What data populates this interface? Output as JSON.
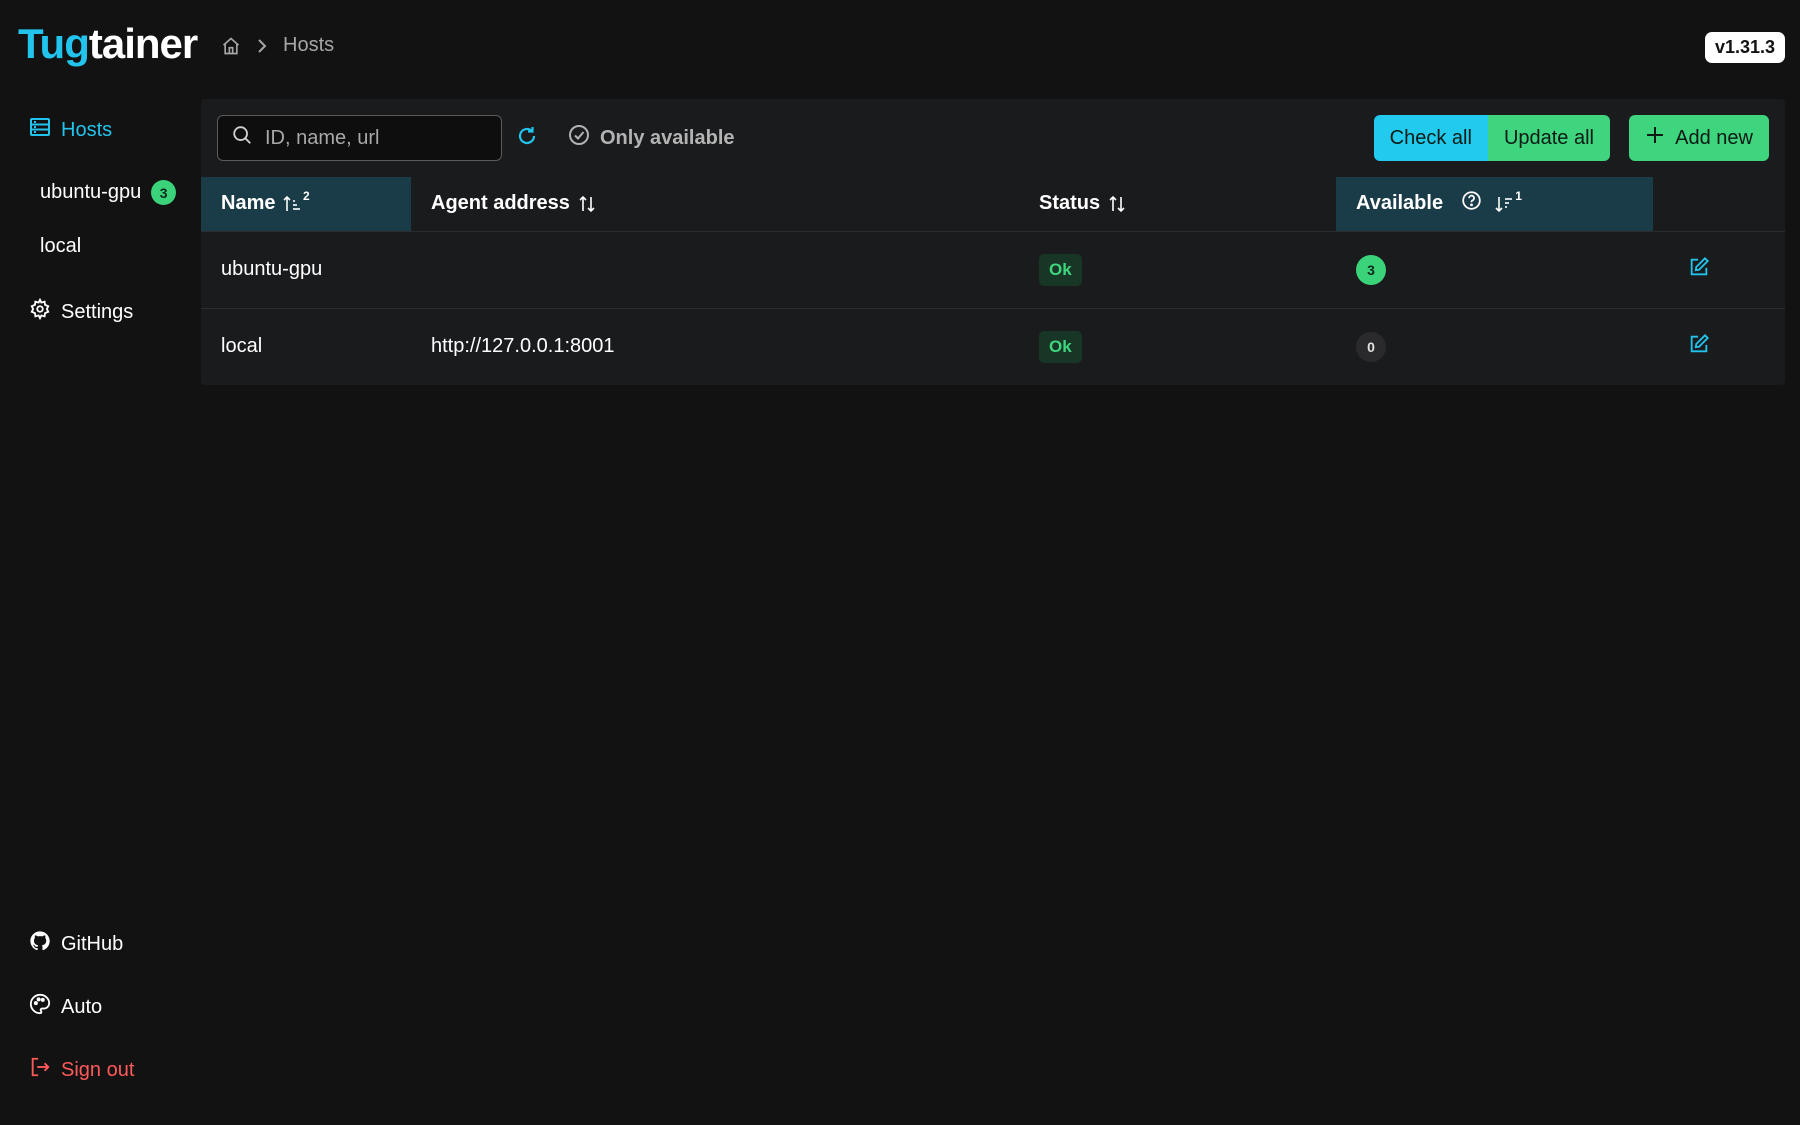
{
  "app": {
    "logo_part1": "Tug",
    "logo_part2": "tainer",
    "version": "v1.31.3"
  },
  "breadcrumb": {
    "home_icon": "home-icon",
    "current": "Hosts"
  },
  "sidebar": {
    "items": [
      {
        "label": "Hosts",
        "icon": "server-icon",
        "active": true
      },
      {
        "label": "Settings",
        "icon": "gear-icon"
      }
    ],
    "hosts": [
      {
        "label": "ubuntu-gpu",
        "badge": "3"
      },
      {
        "label": "local"
      }
    ],
    "bottom": [
      {
        "label": "GitHub",
        "icon": "github-icon"
      },
      {
        "label": "Auto",
        "icon": "palette-icon"
      },
      {
        "label": "Sign out",
        "icon": "sign-out-icon"
      }
    ]
  },
  "toolbar": {
    "search_placeholder": "ID, name, url",
    "only_available": "Only available",
    "check_all": "Check all",
    "update_all": "Update all",
    "add_new": "Add new"
  },
  "table": {
    "columns": [
      {
        "label": "Name",
        "sort_order": "2"
      },
      {
        "label": "Agent address"
      },
      {
        "label": "Status"
      },
      {
        "label": "Available",
        "sort_order": "1"
      }
    ],
    "rows": [
      {
        "name": "ubuntu-gpu",
        "agent_address": "",
        "status": "Ok",
        "available": "3"
      },
      {
        "name": "local",
        "agent_address": "http://127.0.0.1:8001",
        "status": "Ok",
        "available": "0"
      }
    ]
  },
  "colors": {
    "accent": "#22c3ec",
    "success": "#3fd47e",
    "danger": "#ff5a5a",
    "background": "#121212"
  }
}
